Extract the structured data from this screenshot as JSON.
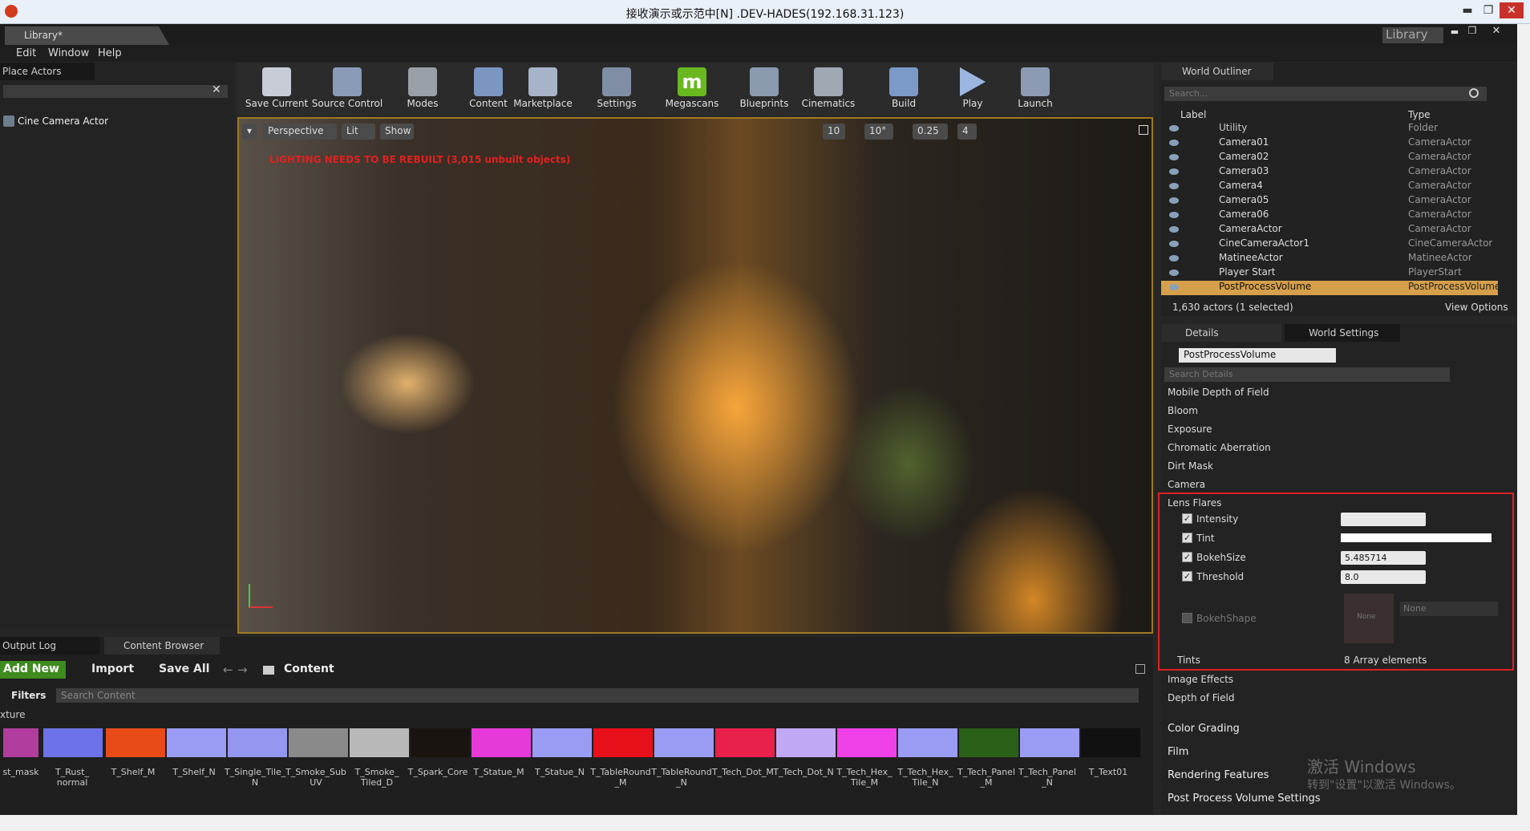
{
  "window": {
    "title": "接收演示或示范中[N] .DEV-HADES(192.168.31.123)",
    "min": "▬",
    "max": "❐",
    "close": "✕"
  },
  "tab": {
    "label": "Library*",
    "right_label": "Library"
  },
  "menu": [
    "Edit",
    "Window",
    "Help"
  ],
  "place_actors": {
    "header": "Place Actors",
    "item": "Cine Camera Actor"
  },
  "toolbar": [
    "Save Current",
    "Source Control",
    "Modes",
    "Content",
    "Marketplace",
    "Settings",
    "Megascans",
    "Blueprints",
    "Cinematics",
    "Build",
    "Play",
    "Launch"
  ],
  "viewport": {
    "perspective": "Perspective",
    "lit": "Lit",
    "show": "Show",
    "warning": "LIGHTING NEEDS TO BE REBUILT (3,015 unbuilt objects)",
    "snap": [
      "10",
      "10°",
      "0.25",
      "4"
    ]
  },
  "world_outliner": {
    "header": "World Outliner",
    "search": "Search...",
    "col_label": "Label",
    "col_type": "Type",
    "rows": [
      [
        "Utility",
        "Folder"
      ],
      [
        "Camera01",
        "CameraActor"
      ],
      [
        "Camera02",
        "CameraActor"
      ],
      [
        "Camera03",
        "CameraActor"
      ],
      [
        "Camera4",
        "CameraActor"
      ],
      [
        "Camera05",
        "CameraActor"
      ],
      [
        "Camera06",
        "CameraActor"
      ],
      [
        "CameraActor",
        "CameraActor"
      ],
      [
        "CineCameraActor1",
        "CineCameraActor"
      ],
      [
        "MatineeActor",
        "MatineeActor"
      ],
      [
        "Player Start",
        "PlayerStart"
      ],
      [
        "PostProcessVolume",
        "PostProcessVolume"
      ]
    ],
    "status": "1,630 actors (1 selected)",
    "view_options": "View Options"
  },
  "details": {
    "tab": "Details",
    "tab2": "World Settings",
    "object": "PostProcessVolume",
    "search": "Search Details",
    "sections": [
      "Mobile Depth of Field",
      "Bloom",
      "Exposure",
      "Chromatic Aberration",
      "Dirt Mask",
      "Camera",
      "Lens Flares"
    ],
    "lens": {
      "intensity": "Intensity",
      "intensity_val": "",
      "tint": "Tint",
      "bokehsize": "BokehSize",
      "bokehsize_val": "5.485714",
      "threshold": "Threshold",
      "threshold_val": "8.0",
      "bokehshape": "BokehShape",
      "none": "None",
      "none2": "None",
      "tints": "Tints",
      "tints_val": "8 Array elements"
    },
    "after": [
      "Image Effects",
      "Depth of Field"
    ],
    "groups": [
      "Color Grading",
      "Film",
      "Rendering Features",
      "Post Process Volume Settings"
    ]
  },
  "bottom": {
    "output_log": "Output Log",
    "content_browser": "Content Browser",
    "add_new": "Add New",
    "import": "Import",
    "save_all": "Save All",
    "path": "Content",
    "filters": "Filters",
    "search": "Search Content",
    "filter_tag": "xture",
    "labels": [
      "st_mask",
      "T_Rust_\nnormal",
      "T_Shelf_M",
      "T_Shelf_N",
      "T_Single_Tile_\nN",
      "T_Smoke_Sub\nUV",
      "T_Smoke_\nTiled_D",
      "T_Spark_Core",
      "T_Statue_M",
      "T_Statue_N",
      "T_TableRound\n_M",
      "T_TableRound\n_N",
      "T_Tech_Dot_M",
      "T_Tech_Dot_N",
      "T_Tech_Hex_\nTile_M",
      "T_Tech_Hex_\nTile_N",
      "T_Tech_Panel\n_M",
      "T_Tech_Panel\n_N",
      "T_Text01"
    ]
  },
  "activate": {
    "line1": "激活 Windows",
    "line2": "转到\"设置\"以激活 Windows。"
  },
  "colors": {
    "selected": "#d6a04a",
    "highlight": "#e02020",
    "accent_green": "#6ab820"
  }
}
